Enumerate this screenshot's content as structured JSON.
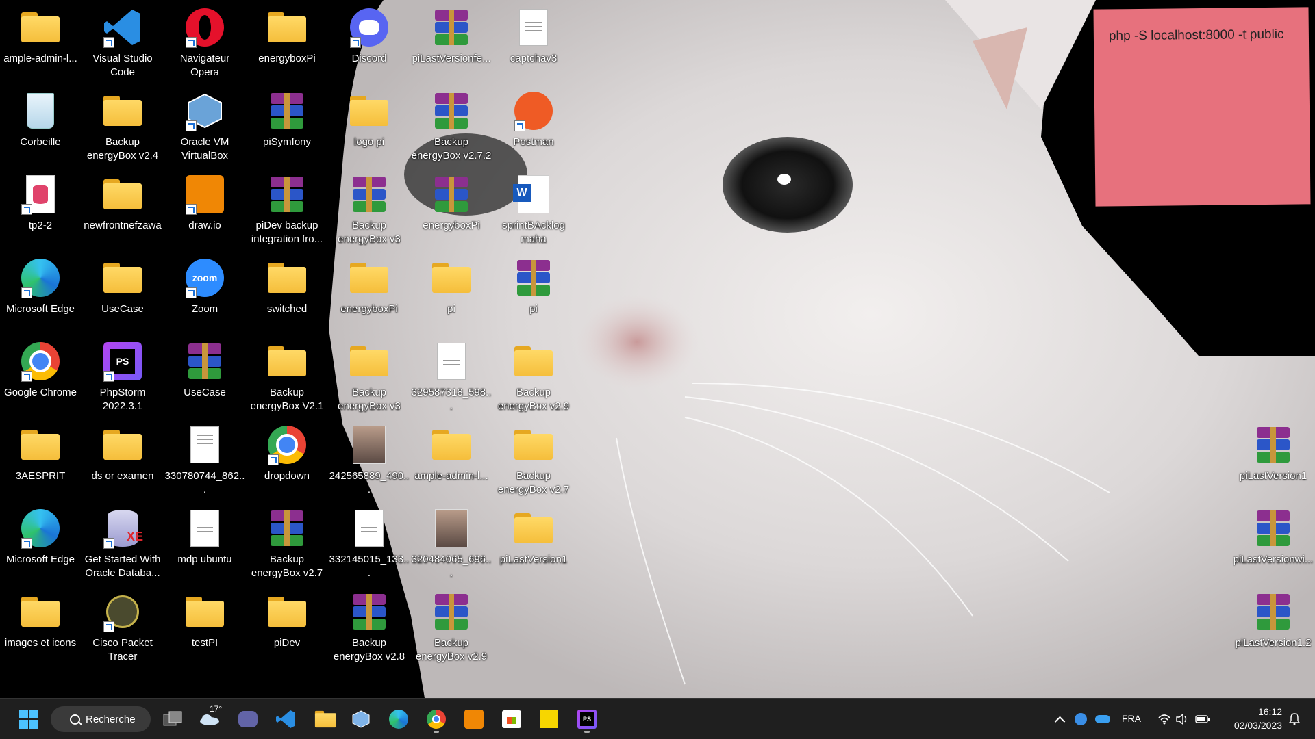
{
  "desktop": {
    "col1": [
      {
        "label": "ample-admin-l...",
        "kind": "folder-chrome"
      },
      {
        "label": "Corbeille",
        "kind": "recycle"
      },
      {
        "label": "tp2-2",
        "kind": "db"
      },
      {
        "label": "Microsoft Edge",
        "kind": "edge"
      },
      {
        "label": "Google Chrome",
        "kind": "chrome"
      },
      {
        "label": "3AESPRIT",
        "kind": "folder"
      },
      {
        "label": "Microsoft Edge",
        "kind": "edge"
      },
      {
        "label": "images et icons",
        "kind": "folder"
      }
    ],
    "col2": [
      {
        "label": "Visual Studio Code",
        "kind": "vscode"
      },
      {
        "label": "Backup energyBox v2.4",
        "kind": "folder-zip"
      },
      {
        "label": "newfrontnefzawa",
        "kind": "folder"
      },
      {
        "label": "UseCase",
        "kind": "folder"
      },
      {
        "label": "PhpStorm 2022.3.1",
        "kind": "phpstorm"
      },
      {
        "label": "ds or examen",
        "kind": "folder"
      },
      {
        "label": "Get Started With Oracle Databa...",
        "kind": "oracle"
      },
      {
        "label": "Cisco Packet Tracer",
        "kind": "cisco"
      }
    ],
    "col3": [
      {
        "label": "Navigateur Opera",
        "kind": "opera"
      },
      {
        "label": "Oracle VM VirtualBox",
        "kind": "virtualbox"
      },
      {
        "label": "draw.io",
        "kind": "drawio"
      },
      {
        "label": "Zoom",
        "kind": "zoom"
      },
      {
        "label": "UseCase",
        "kind": "rar"
      },
      {
        "label": "330780744_862...",
        "kind": "doc"
      },
      {
        "label": "mdp ubuntu",
        "kind": "doc"
      },
      {
        "label": "testPI",
        "kind": "folder"
      }
    ],
    "col4": [
      {
        "label": "energyboxPi",
        "kind": "folder"
      },
      {
        "label": "piSymfony",
        "kind": "rar"
      },
      {
        "label": "piDev backup integration fro...",
        "kind": "rar"
      },
      {
        "label": "switched",
        "kind": "folder"
      },
      {
        "label": "Backup energyBox V2.1",
        "kind": "folder-zip"
      },
      {
        "label": "dropdown",
        "kind": "chrome"
      },
      {
        "label": "Backup energyBox v2.7",
        "kind": "rar"
      },
      {
        "label": "piDev",
        "kind": "folder"
      }
    ],
    "col5": [
      {
        "label": "Discord",
        "kind": "discord"
      },
      {
        "label": "logo pi",
        "kind": "folder-zip"
      },
      {
        "label": "Backup energyBox v3",
        "kind": "rar"
      },
      {
        "label": "energyboxPi",
        "kind": "folder-zip"
      },
      {
        "label": "Backup energyBox v3",
        "kind": "folder"
      },
      {
        "label": "242565889_490...",
        "kind": "photo"
      },
      {
        "label": "332145015_133...",
        "kind": "doc"
      },
      {
        "label": "Backup energyBox v2.8",
        "kind": "rar"
      }
    ],
    "col6": [
      {
        "label": "piLastVersionfe...",
        "kind": "rar"
      },
      {
        "label": "Backup energyBox v2.7.2",
        "kind": "rar"
      },
      {
        "label": "energyboxPi",
        "kind": "rar"
      },
      {
        "label": "pi",
        "kind": "folder"
      },
      {
        "label": "329587318_598...",
        "kind": "doc"
      },
      {
        "label": "ample-admin-l...",
        "kind": "folder-zip"
      },
      {
        "label": "320484065_696...",
        "kind": "photo"
      },
      {
        "label": "Backup energyBox v2.9",
        "kind": "rar"
      }
    ],
    "col7": [
      {
        "label": "captchav3",
        "kind": "doc"
      },
      {
        "label": "Postman",
        "kind": "postman"
      },
      {
        "label": "sprintBAcklog maha",
        "kind": "word"
      },
      {
        "label": "pi",
        "kind": "rar"
      },
      {
        "label": "Backup energyBox v2.9",
        "kind": "folder"
      },
      {
        "label": "Backup energyBox v2.7",
        "kind": "folder"
      },
      {
        "label": "piLastVersion1",
        "kind": "folder"
      }
    ],
    "right": [
      {
        "label": "piLastVersion1",
        "kind": "rar"
      },
      {
        "label": "piLastVersionwi...",
        "kind": "rar"
      },
      {
        "label": "piLastVersion1.2",
        "kind": "rar"
      }
    ]
  },
  "sticky_note": {
    "text": "php -S localhost:8000 -t public",
    "color": "#e7717d"
  },
  "taskbar": {
    "search_label": "Recherche",
    "weather_temp": "17°",
    "language": "FRA",
    "time": "16:12",
    "date": "02/03/2023"
  }
}
